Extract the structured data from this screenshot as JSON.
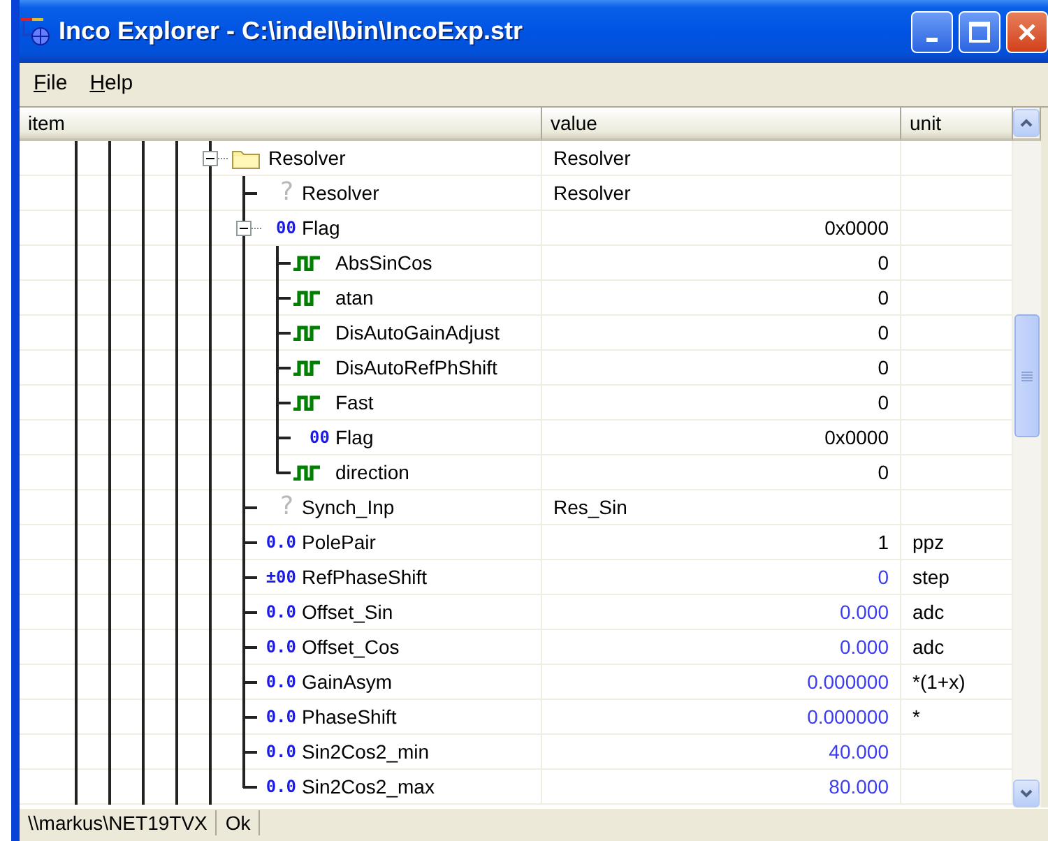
{
  "window": {
    "title": "Inco Explorer - C:\\indel\\bin\\IncoExp.str"
  },
  "menu": [
    {
      "label": "File"
    },
    {
      "label": "Help"
    }
  ],
  "columns": [
    "item",
    "value",
    "unit"
  ],
  "tree": [
    {
      "kind": "folder",
      "name": "Resolver",
      "value": "Resolver",
      "expanded": true,
      "children": [
        {
          "kind": "unknown",
          "badge": "?",
          "name": "Resolver",
          "value": "Resolver"
        },
        {
          "kind": "flags",
          "badge": "00",
          "name": "Flag",
          "value": "0x0000",
          "expanded": true,
          "children": [
            {
              "kind": "bit",
              "name": "AbsSinCos",
              "value": "0"
            },
            {
              "kind": "bit",
              "name": "atan",
              "value": "0"
            },
            {
              "kind": "bit",
              "name": "DisAutoGainAdjust",
              "value": "0"
            },
            {
              "kind": "bit",
              "name": "DisAutoRefPhShift",
              "value": "0"
            },
            {
              "kind": "bit",
              "name": "Fast",
              "value": "0"
            },
            {
              "kind": "flags",
              "badge": "00",
              "name": "Flag",
              "value": "0x0000"
            },
            {
              "kind": "bit",
              "name": "direction",
              "value": "0"
            }
          ]
        },
        {
          "kind": "unknown",
          "badge": "?",
          "name": "Synch_Inp",
          "value": "Res_Sin"
        },
        {
          "kind": "number",
          "badge": "0.0",
          "name": "PolePair",
          "value": "1",
          "unit": "ppz",
          "editable": false
        },
        {
          "kind": "number",
          "badge": "±00",
          "name": "RefPhaseShift",
          "value": "0",
          "unit": "step",
          "editable": true
        },
        {
          "kind": "number",
          "badge": "0.0",
          "name": "Offset_Sin",
          "value": "0.000",
          "unit": "adc",
          "editable": true
        },
        {
          "kind": "number",
          "badge": "0.0",
          "name": "Offset_Cos",
          "value": "0.000",
          "unit": "adc",
          "editable": true
        },
        {
          "kind": "number",
          "badge": "0.0",
          "name": "GainAsym",
          "value": "0.000000",
          "unit": "*(1+x)",
          "editable": true
        },
        {
          "kind": "number",
          "badge": "0.0",
          "name": "PhaseShift",
          "value": "0.000000",
          "unit": "*",
          "editable": true
        },
        {
          "kind": "number",
          "badge": "0.0",
          "name": "Sin2Cos2_min",
          "value": "40.000",
          "editable": true
        },
        {
          "kind": "number",
          "badge": "0.0",
          "name": "Sin2Cos2_max",
          "value": "80.000",
          "editable": true
        }
      ]
    }
  ],
  "status_bar": [
    "\\\\markus\\NET19TVX",
    "Ok"
  ]
}
